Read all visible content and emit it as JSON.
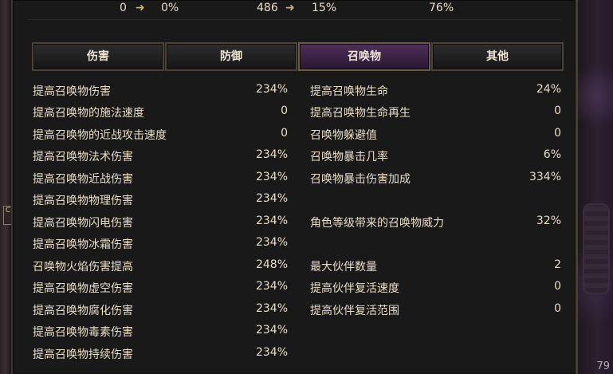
{
  "top": {
    "a_from": "0",
    "a_to": "0%",
    "b_from": "486",
    "b_to": "15%",
    "c": "76%"
  },
  "tabs": [
    {
      "label": "伤害"
    },
    {
      "label": "防御"
    },
    {
      "label": "召唤物"
    },
    {
      "label": "其他"
    }
  ],
  "active_tab": 2,
  "left_stats": [
    {
      "label": "提高召唤物伤害",
      "value": "234%"
    },
    {
      "label": "提高召唤物的施法速度",
      "value": "0"
    },
    {
      "label": "提高召唤物的近战攻击速度",
      "value": "0"
    },
    {
      "label": "提高召唤物法术伤害",
      "value": "234%"
    },
    {
      "label": "提高召唤物近战伤害",
      "value": "234%"
    },
    {
      "label": "提高召唤物物理伤害",
      "value": "234%"
    },
    {
      "label": "提高召唤物闪电伤害",
      "value": "234%"
    },
    {
      "label": "提高召唤物冰霜伤害",
      "value": "234%"
    },
    {
      "label": "召唤物火焰伤害提高",
      "value": "248%"
    },
    {
      "label": "提高召唤物虚空伤害",
      "value": "234%"
    },
    {
      "label": "提高召唤物腐化伤害",
      "value": "234%"
    },
    {
      "label": "提高召唤物毒素伤害",
      "value": "234%"
    },
    {
      "label": "提高召唤物持续伤害",
      "value": "234%"
    }
  ],
  "right_stats": [
    {
      "label": "提高召唤物生命",
      "value": "24%"
    },
    {
      "label": "提高召唤物生命再生",
      "value": "0"
    },
    {
      "label": "召唤物躲避值",
      "value": "0"
    },
    {
      "label": "召唤物暴击几率",
      "value": "6%"
    },
    {
      "label": "召唤物暴击伤害加成",
      "value": "334%"
    },
    {
      "label": "角色等级带来的召唤物威力",
      "value": "32%"
    },
    {
      "label": "最大伙伴数量",
      "value": "2"
    },
    {
      "label": "提高伙伴复活速度",
      "value": "0"
    },
    {
      "label": "提高伙伴复活范围",
      "value": "0"
    }
  ],
  "page_number": "79",
  "left_tab_text": "C"
}
